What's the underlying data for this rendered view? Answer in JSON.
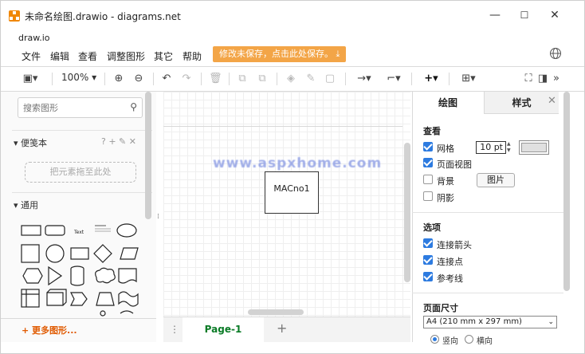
{
  "window": {
    "title": "未命名绘图.drawio - diagrams.net",
    "subtitle": "draw.io",
    "minimize": "—",
    "maximize": "☐",
    "close": "✕"
  },
  "menu": {
    "items": [
      "文件",
      "编辑",
      "查看",
      "调整图形",
      "其它",
      "帮助"
    ],
    "save_notice": "修改未保存，点击此处保存。"
  },
  "toolbar": {
    "zoom": "100%"
  },
  "sidebar": {
    "search_placeholder": "搜索图形",
    "scratchpad_title": "便笺本",
    "scratchpad_tools": "? + ✎ ✕",
    "drop_hint": "把元素拖至此处",
    "general_title": "通用",
    "text_shape": "Text",
    "more_shapes": "+ 更多图形..."
  },
  "canvas": {
    "watermark": "www.aspxhome.com",
    "box_label": "MACno1"
  },
  "pages": {
    "active_tab": "Page-1",
    "menu_icon": "⋮",
    "add_icon": "+"
  },
  "format_panel": {
    "tabs": [
      "绘图",
      "样式"
    ],
    "close": "✕",
    "view_title": "查看",
    "grid_label": "网格",
    "grid_size": "10 pt",
    "page_view_label": "页面视图",
    "background_label": "背景",
    "image_button": "图片",
    "shadow_label": "阴影",
    "options_title": "选项",
    "connection_arrows_label": "连接箭头",
    "connection_points_label": "连接点",
    "guides_label": "参考线",
    "paper_size_title": "页面尺寸",
    "paper_size_value": "A4 (210 mm x 297 mm)",
    "portrait_label": "竖向",
    "landscape_label": "横向"
  },
  "colors": {
    "brand_orange": "#f08705",
    "save_notice_bg": "#f3a547",
    "checkbox_blue": "#2d7be0",
    "page_tab_green": "#0a7b26",
    "more_shapes_orange": "#e05a00"
  }
}
